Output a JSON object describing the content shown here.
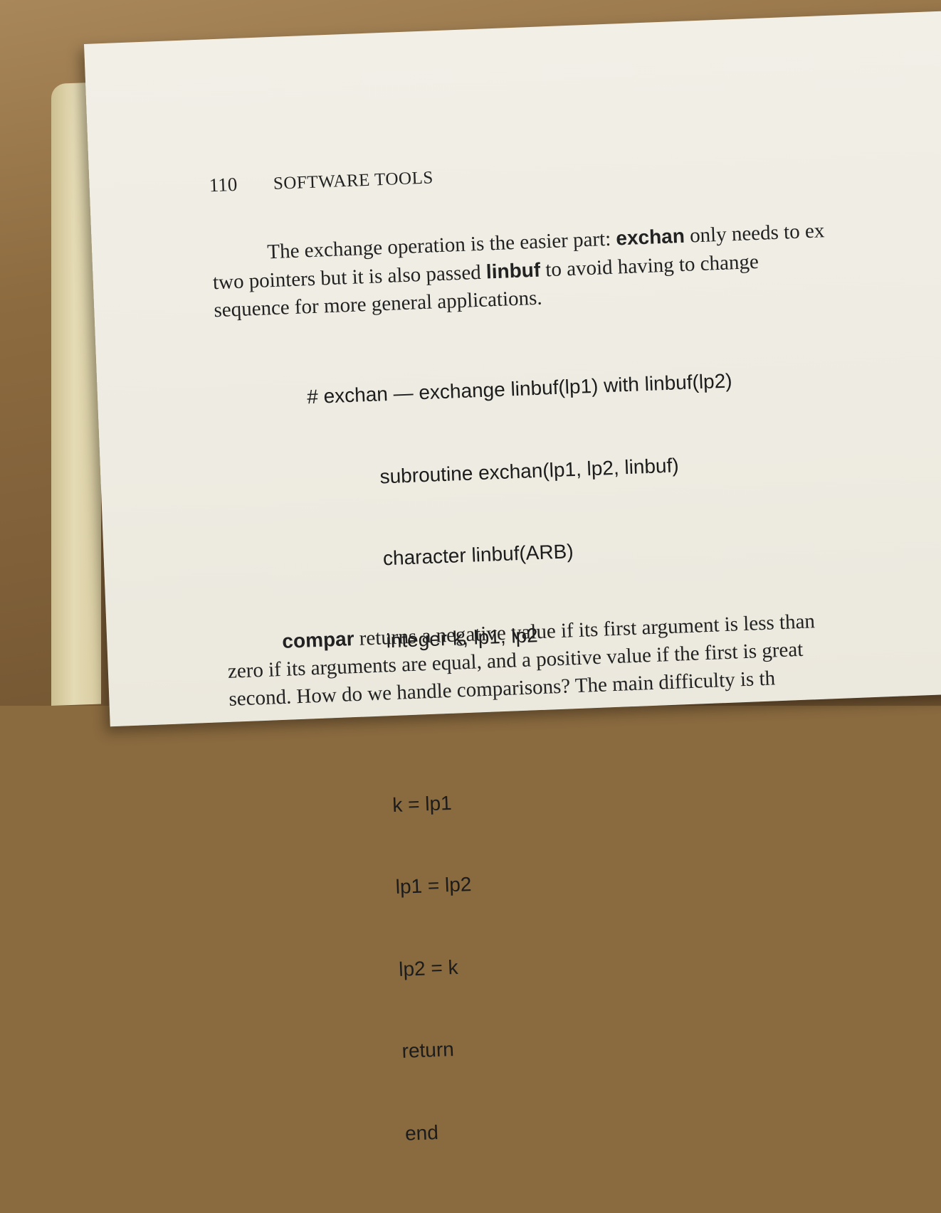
{
  "book": {
    "page_number": "110",
    "running_title": "SOFTWARE TOOLS"
  },
  "paragraph1": {
    "line1_a": "The exchange operation is the easier part: ",
    "line1_code": "exchan",
    "line1_b": " only needs to ex",
    "line2_a": "two pointers but it is also passed ",
    "line2_code": "linbuf",
    "line2_b": " to avoid having to change",
    "line3": "sequence for more general applications."
  },
  "code": {
    "comment": "# exchan — exchange linbuf(lp1) with linbuf(lp2)",
    "decl1": "subroutine exchan(lp1, lp2, linbuf)",
    "decl2": "character linbuf(ARB)",
    "decl3": "integer k, lp1, lp2",
    "stmt1": "k = lp1",
    "stmt2": "lp1 = lp2",
    "stmt3": "lp2 = k",
    "stmt4": "return",
    "stmt5": "end"
  },
  "paragraph2": {
    "line1_code": "compar",
    "line1_b": " returns a negative value if its first argument is less than",
    "line2": "zero if its arguments are equal, and a positive value if the first is great",
    "line3": "second.  How do we handle comparisons?  The main difficulty is th"
  }
}
